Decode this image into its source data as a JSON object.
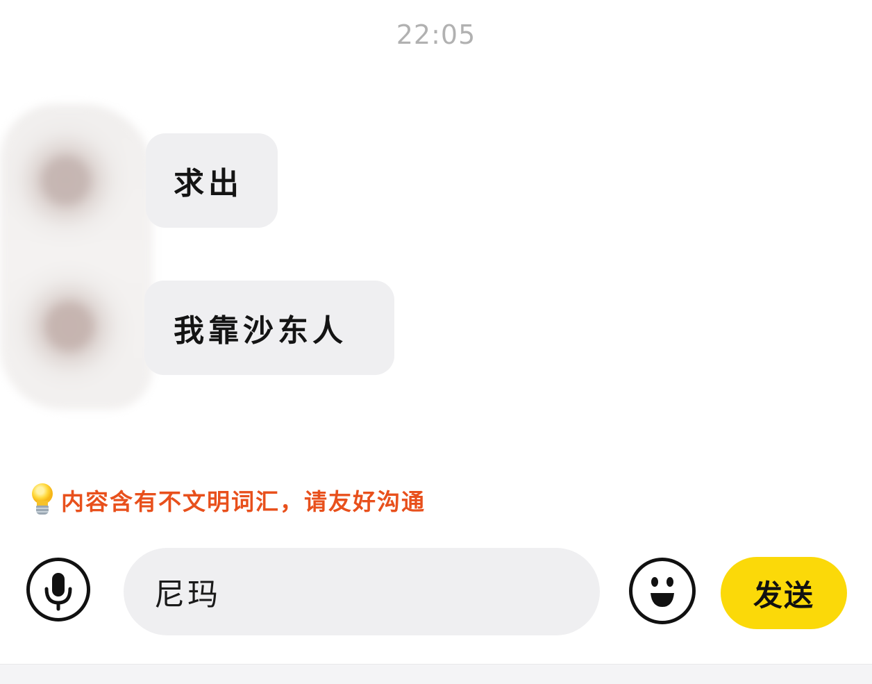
{
  "header": {
    "time": "22:05"
  },
  "messages": [
    {
      "text": "求出"
    },
    {
      "text": "我靠沙东人"
    }
  ],
  "warning": {
    "text": "内容含有不文明词汇，请友好沟通",
    "icon": "lightbulb-icon",
    "color": "#e8501c"
  },
  "composer": {
    "input_value": "尼玛",
    "send_label": "发送",
    "voice_icon": "microphone-icon",
    "emoji_icon": "smiley-icon",
    "send_color": "#fbd909"
  }
}
